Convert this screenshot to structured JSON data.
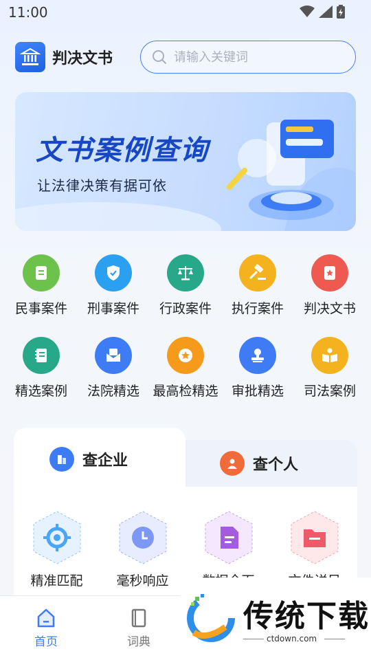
{
  "status_bar": {
    "time": "11:00"
  },
  "header": {
    "app_title": "判决文书",
    "search_placeholder": "请输入关键词"
  },
  "banner": {
    "title": "文书案例查询",
    "subtitle": "让法律决策有据可依"
  },
  "categories": [
    {
      "label": "民事案件",
      "icon": "document-icon",
      "color": "#6cc24a"
    },
    {
      "label": "刑事案件",
      "icon": "shield-check-icon",
      "color": "#2b9ff0"
    },
    {
      "label": "行政案件",
      "icon": "scales-icon",
      "color": "#27a889"
    },
    {
      "label": "执行案件",
      "icon": "gavel-icon",
      "color": "#f5b21f"
    },
    {
      "label": "判决文书",
      "icon": "star-card-icon",
      "color": "#ef5a50"
    },
    {
      "label": "精选案例",
      "icon": "notebook-icon",
      "color": "#27a889"
    },
    {
      "label": "法院精选",
      "icon": "envelope-icon",
      "color": "#3d7cf5"
    },
    {
      "label": "最高检精选",
      "icon": "star-badge-icon",
      "color": "#f59a1b"
    },
    {
      "label": "审批精选",
      "icon": "stamp-icon",
      "color": "#3d7cf5"
    },
    {
      "label": "司法案例",
      "icon": "open-book-icon",
      "color": "#f5b21f"
    }
  ],
  "tabs": {
    "enterprise": {
      "label": "查企业",
      "icon": "building-icon",
      "color": "#3d7cf5"
    },
    "person": {
      "label": "查个人",
      "icon": "person-icon",
      "color": "#f06a3a"
    }
  },
  "features": [
    {
      "label": "精准匹配",
      "icon": "target-icon",
      "color": "#4aa5f5"
    },
    {
      "label": "毫秒响应",
      "icon": "clock-icon",
      "color": "#5b7cf0"
    },
    {
      "label": "数据全面",
      "icon": "file-icon",
      "color": "#a35be0"
    },
    {
      "label": "文件详尽",
      "icon": "folder-icon",
      "color": "#ef5a6a"
    }
  ],
  "bottom_nav": [
    {
      "label": "首页",
      "icon": "home-icon",
      "active": true
    },
    {
      "label": "词典",
      "icon": "dictionary-icon",
      "active": false
    }
  ],
  "colors": {
    "accent": "#3d7cf5",
    "active_nav": "#3d7cf5",
    "inactive_nav": "#888888"
  },
  "watermark": {
    "text": "传统下载",
    "url": "ctdown.com"
  }
}
